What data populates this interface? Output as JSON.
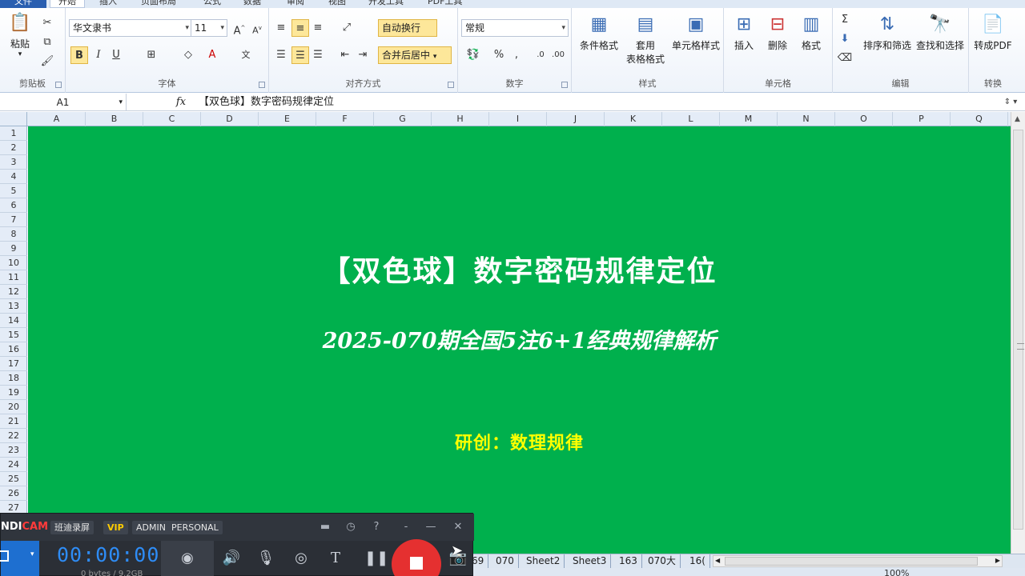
{
  "ribbon_tabs": [
    {
      "label": "文件",
      "active": false
    },
    {
      "label": "开始",
      "active": true
    },
    {
      "label": "插入",
      "active": false
    },
    {
      "label": "页面布局",
      "active": false
    },
    {
      "label": "公式",
      "active": false
    },
    {
      "label": "数据",
      "active": false
    },
    {
      "label": "审阅",
      "active": false
    },
    {
      "label": "视图",
      "active": false
    },
    {
      "label": "开发工具",
      "active": false
    },
    {
      "label": "PDF工具",
      "active": false
    }
  ],
  "ribbon": {
    "clipboard": {
      "paste_label": "粘贴",
      "group_label": "剪贴板"
    },
    "font": {
      "font_name": "华文隶书",
      "font_size": "11",
      "bold": "B",
      "italic": "I",
      "underline": "U",
      "group_label": "字体"
    },
    "alignment": {
      "wrap_text": "自动换行",
      "merge_center": "合并后居中",
      "group_label": "对齐方式"
    },
    "number": {
      "format": "常规",
      "percent": "%",
      "comma": ",",
      "group_label": "数字"
    },
    "styles": {
      "conditional": "条件格式",
      "table_format_line1": "套用",
      "table_format_line2": "表格格式",
      "cell_styles": "单元格样式",
      "group_label": "样式"
    },
    "cells": {
      "insert": "插入",
      "delete": "删除",
      "format": "格式",
      "group_label": "单元格"
    },
    "editing": {
      "sum": "Σ",
      "sort_filter": "排序和筛选",
      "find_select": "查找和选择",
      "group_label": "编辑"
    },
    "convert": {
      "to_pdf": "转成PDF",
      "group_label": "转换"
    }
  },
  "formula_bar": {
    "name_box": "A1",
    "fx": "fx",
    "formula": "【双色球】数字密码规律定位"
  },
  "columns": [
    "A",
    "B",
    "C",
    "D",
    "E",
    "F",
    "G",
    "H",
    "I",
    "J",
    "K",
    "L",
    "M",
    "N",
    "O",
    "P",
    "Q"
  ],
  "rows": [
    "1",
    "2",
    "3",
    "4",
    "5",
    "6",
    "7",
    "8",
    "9",
    "10",
    "11",
    "12",
    "13",
    "14",
    "15",
    "16",
    "17",
    "18",
    "19",
    "20",
    "21",
    "22",
    "23",
    "24",
    "25",
    "26",
    "27"
  ],
  "sheet": {
    "background_color": "#00b04d",
    "title": "【双色球】数字密码规律定位",
    "subtitle": "2025-070期全国5注6+1经典规律解析",
    "author": "研创：数理规律",
    "author_color": "#ffff00"
  },
  "sheet_tabs": [
    "69",
    "070",
    "Sheet2",
    "Sheet3",
    "163",
    "070大",
    "16("
  ],
  "status": {
    "zoom": "100%"
  },
  "bandicam": {
    "logo_prefix": "NDI",
    "logo_accent": "CAM",
    "product": "班迪录屏",
    "badges": [
      "VIP",
      "ADMIN",
      "PERSONAL"
    ],
    "timer": "00:00:00",
    "size": "0 bytes / 9.2GB",
    "accent_color": "#2e8cf5",
    "record_color": "#e53030"
  }
}
